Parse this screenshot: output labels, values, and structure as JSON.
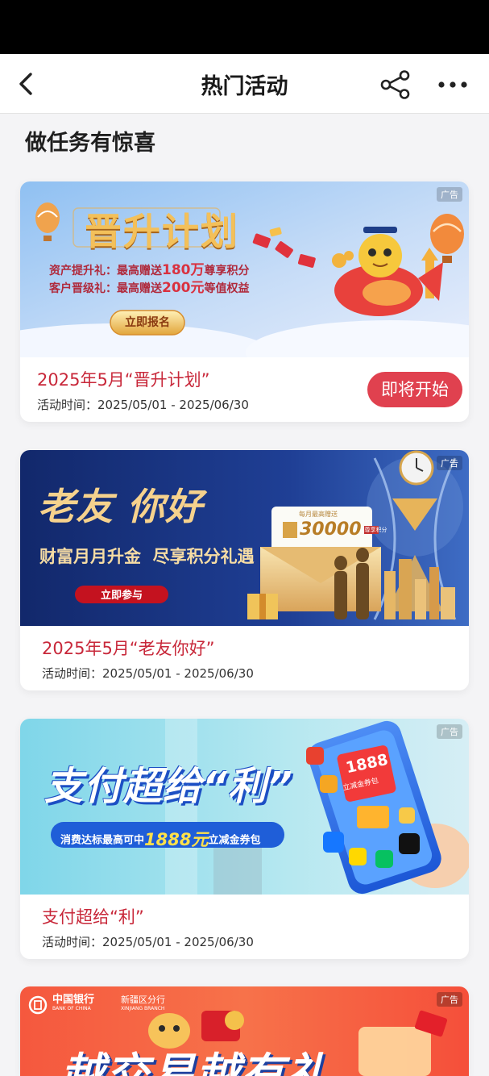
{
  "nav": {
    "title": "热门活动"
  },
  "section": {
    "title": "做任务有惊喜"
  },
  "ad_label": "广告",
  "cards": [
    {
      "title": "2025年5月“晋升计划”",
      "time": "活动时间：2025/05/01 - 2025/06/30",
      "status": "即将开始",
      "banner": {
        "headline": "晋升计划",
        "line1_prefix": "资产提升礼：最高赠送",
        "line1_value": "180万",
        "line1_suffix": "尊享积分",
        "line2_prefix": "客户晋级礼：最高赠送",
        "line2_value": "200元",
        "line2_suffix": "等值权益",
        "cta": "立即报名"
      }
    },
    {
      "title": "2025年5月“老友你好”",
      "time": "活动时间：2025/05/01 - 2025/06/30",
      "banner": {
        "headline": "老友 你好",
        "subline": "财富月月升金  尽享积分礼遇",
        "cta": "立即参与",
        "envelope_caption": "每月最高赠送",
        "envelope_value": "30000",
        "envelope_unit": "尊享积分"
      }
    },
    {
      "title": "支付超给“利”",
      "time": "活动时间：2025/05/01 - 2025/06/30",
      "banner": {
        "headline": "支付超给“利”",
        "sub_prefix": "消费达标最高可中",
        "sub_value": "1888元",
        "sub_suffix": "立减金券包",
        "phone_value": "1888",
        "phone_caption": "立减金券包"
      }
    },
    {
      "banner": {
        "bank_cn": "中国银行",
        "bank_en": "BANK OF CHINA",
        "branch_cn": "新疆区分行",
        "branch_en": "XINJIANG BRANCH",
        "headline": "越交易越有礼"
      }
    }
  ]
}
